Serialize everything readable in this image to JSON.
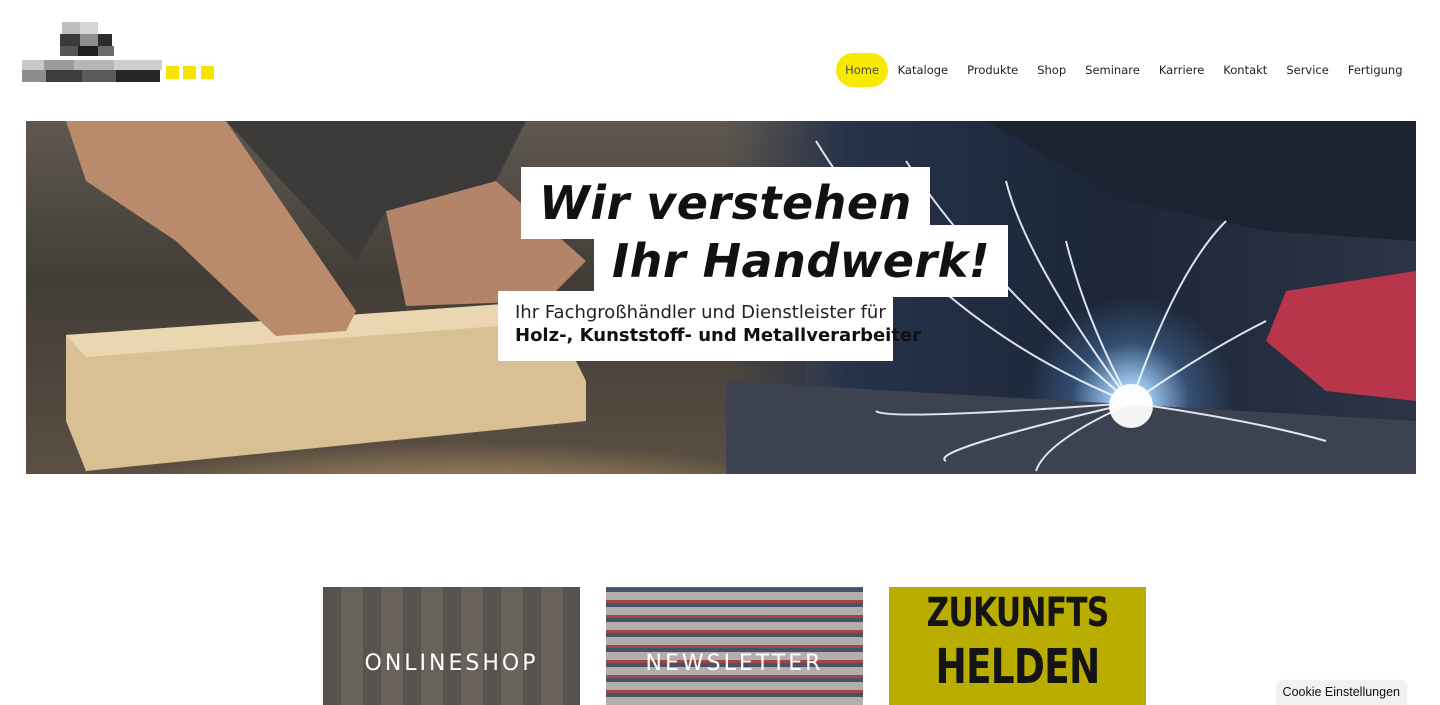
{
  "header": {
    "logo_name": "company-logo",
    "logo_accent_color": "#f5e400"
  },
  "nav": {
    "items": [
      {
        "label": "Home",
        "active": true
      },
      {
        "label": "Kataloge",
        "active": false
      },
      {
        "label": "Produkte",
        "active": false
      },
      {
        "label": "Shop",
        "active": false
      },
      {
        "label": "Seminare",
        "active": false
      },
      {
        "label": "Karriere",
        "active": false
      },
      {
        "label": "Kontakt",
        "active": false
      },
      {
        "label": "Service",
        "active": false
      },
      {
        "label": "Fertigung",
        "active": false
      }
    ],
    "active_color": "#f7ea00"
  },
  "hero": {
    "tagline_line1": "Wir verstehen",
    "tagline_line2": "Ihr Handwerk!",
    "sub_line1": "Ihr Fachgroßhändler und Dienstleister für",
    "sub_line2": "Holz-, Kunststoff- und Metallverarbeiter"
  },
  "tiles": {
    "shop_label": "ONLINESHOP",
    "newsletter_label": "NEWSLETTER",
    "heroes_line1": "ZUKUNFTS",
    "heroes_line2": "HELDEN",
    "heroes_color": "#b9ad00"
  },
  "cookie": {
    "label": "Cookie Einstellungen"
  }
}
